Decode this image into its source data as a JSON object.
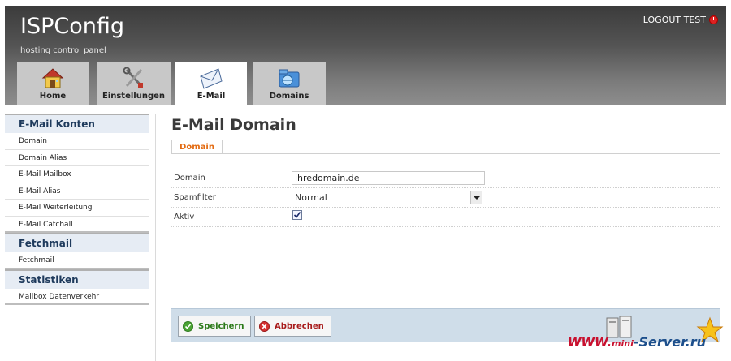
{
  "header": {
    "logo": "ISPConfig",
    "tagline": "hosting control panel",
    "logout_label": "LOGOUT TEST"
  },
  "tabs": [
    {
      "label": "Home",
      "icon": "home-icon"
    },
    {
      "label": "Einstellungen",
      "icon": "tools-icon"
    },
    {
      "label": "E-Mail",
      "icon": "envelope-icon",
      "active": true
    },
    {
      "label": "Domains",
      "icon": "domains-icon"
    }
  ],
  "sidebar": {
    "sections": [
      {
        "title": "E-Mail Konten",
        "items": [
          "Domain",
          "Domain Alias",
          "E-Mail Mailbox",
          "E-Mail Alias",
          "E-Mail Weiterleitung",
          "E-Mail Catchall"
        ]
      },
      {
        "title": "Fetchmail",
        "items": [
          "Fetchmail"
        ]
      },
      {
        "title": "Statistiken",
        "items": [
          "Mailbox Datenverkehr"
        ]
      }
    ]
  },
  "main": {
    "title": "E-Mail Domain",
    "tab_label": "Domain",
    "form": {
      "domain_label": "Domain",
      "domain_value": "ihredomain.de",
      "spam_label": "Spamfilter",
      "spam_value": "Normal",
      "aktiv_label": "Aktiv",
      "aktiv_checked": true
    },
    "buttons": {
      "save_label": "Speichern",
      "cancel_label": "Abbrechen"
    }
  },
  "watermark": {
    "prefix": "WWW.",
    "mini": "mini",
    "suffix": "-Server.ru"
  },
  "colors": {
    "accent": "#e36b12",
    "sidebar_heading": "#1e3a5c",
    "save": "#2c7a1a",
    "cancel": "#a81b1b",
    "button_bar": "#cfdde9"
  }
}
